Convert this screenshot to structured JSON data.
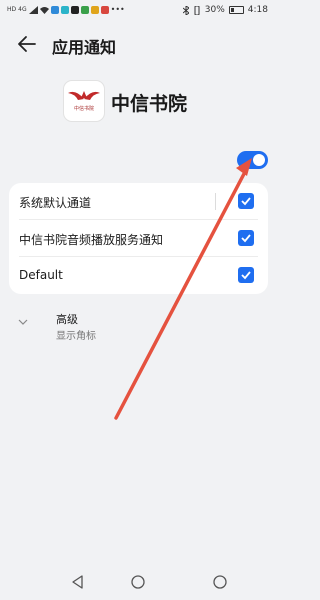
{
  "status_bar": {
    "carrier_badges": [
      "HD",
      "4G"
    ],
    "battery_percent": "30%",
    "time": "4:18"
  },
  "header": {
    "title": "应用通知"
  },
  "app": {
    "name": "中信书院",
    "icon_caption": "中信书院",
    "notifications_enabled": true
  },
  "channels": [
    {
      "label": "系统默认通道",
      "checked": true
    },
    {
      "label": "中信书院音频播放服务通知",
      "checked": true
    },
    {
      "label": "Default",
      "checked": true
    }
  ],
  "advanced": {
    "title": "高级",
    "subtitle": "显示角标"
  },
  "colors": {
    "accent": "#1f6ef0",
    "annotation_arrow": "#e5523f",
    "background": "#f1f2f4"
  },
  "icons": {
    "back": "arrow-left",
    "expand": "chevron-down",
    "nav": [
      "triangle-back",
      "circle-home",
      "circle-recents"
    ]
  }
}
